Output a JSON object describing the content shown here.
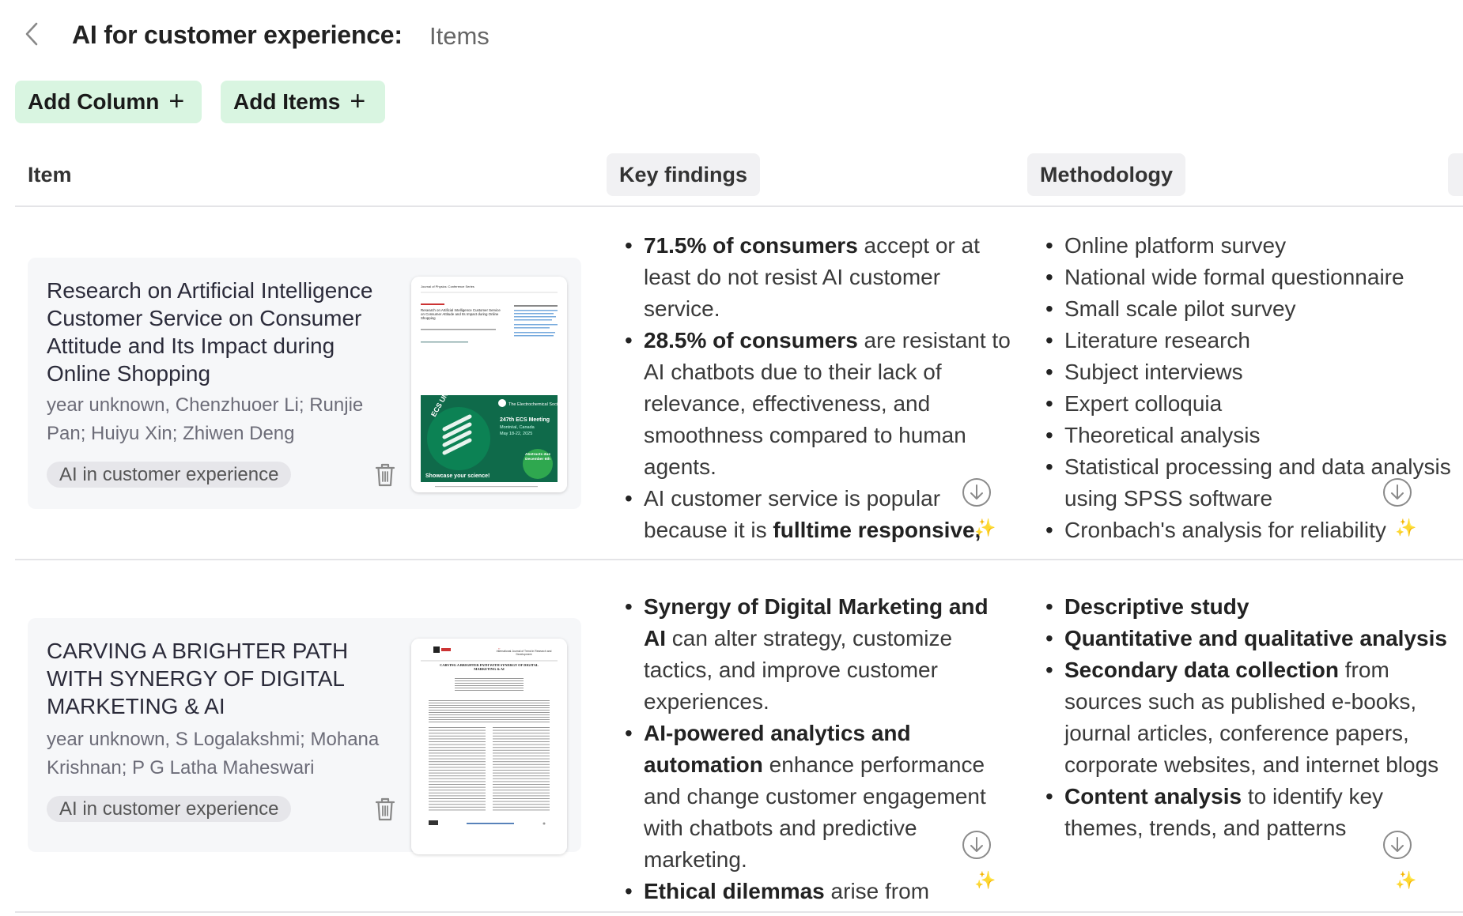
{
  "header": {
    "title": "AI for customer experience:",
    "subtitle": "Items"
  },
  "toolbar": {
    "add_column": "Add Column",
    "add_items": "Add Items",
    "plus": "+"
  },
  "columns": {
    "item": "Item",
    "key_findings": "Key findings",
    "methodology": "Methodology"
  },
  "rows": [
    {
      "title": "Research on Artificial Intelligence Customer Service on Consumer Attitude and Its Impact during Online Shopping",
      "meta": "year unknown, Chenzhuoer Li; Runjie Pan; Huiyu Xin; Zhiwen Deng",
      "tag": "AI in customer experience",
      "key_findings": [
        {
          "bold": "71.5% of consumers",
          "rest": " accept or at least do not resist AI customer service."
        },
        {
          "bold": "28.5% of consumers",
          "rest": " are resistant to AI chatbots due to their lack of relevance, effectiveness, and smoothness compared to human agents."
        },
        {
          "lead": "AI customer service is popular because it is ",
          "bold": "fulltime responsive,"
        }
      ],
      "methodology": [
        "Online platform survey",
        "National wide formal questionnaire",
        "Small scale pilot survey",
        "Literature research",
        "Subject interviews",
        "Expert colloquia",
        "Theoretical analysis",
        "Statistical processing and data analysis using SPSS software",
        "Cronbach's analysis for reliability"
      ]
    },
    {
      "title": "CARVING A BRIGHTER PATH WITH SYNERGY OF DIGITAL MARKETING & AI",
      "meta": "year unknown, S Logalakshmi; Mohana Krishnan; P G Latha Maheswari",
      "tag": "AI in customer experience",
      "key_findings": [
        {
          "bold": "Synergy of Digital Marketing and AI",
          "rest": " can alter strategy, customize tactics, and improve customer experiences."
        },
        {
          "bold": "AI-powered analytics and automation",
          "rest": " enhance performance and change customer engagement with chatbots and predictive marketing."
        },
        {
          "bold": "Ethical dilemmas",
          "rest": " arise from"
        }
      ],
      "methodology": [
        {
          "bold": "Descriptive study",
          "rest": ""
        },
        {
          "bold": "Quantitative and qualitative analysis",
          "rest": ""
        },
        {
          "bold": "Secondary data collection",
          "rest": " from sources such as published e-books, journal articles, conference papers, corporate websites, and internet blogs"
        },
        {
          "bold": "Content analysis",
          "rest": " to identify key themes, trends, and patterns"
        }
      ]
    }
  ],
  "thumbnails": {
    "paper1": {
      "journal": "Journal of Physics: Conference Series",
      "title": "Research on Artificial Intelligence Customer Service on Consumer Attitude and Its Impact during Online Shopping",
      "ad_badge": "ECS UNITED",
      "ad_society": "The Electrochemical Society",
      "ad_meeting": "247th ECS Meeting",
      "ad_location": "Montréal, Canada",
      "ad_dates": "May 18-22, 2025",
      "ad_cta": "Showcase your science!",
      "ad_deadline": "Abstracts due December 6th"
    },
    "paper2": {
      "journal": "International Journal of Trend in Research and Development",
      "title": "CARVING A BRIGHTER PATH WITH SYNERGY OF DIGITAL MARKETING & AI"
    }
  },
  "colors": {
    "accent_green": "#d9f5e1",
    "card_bg": "#f6f7f9",
    "divider": "#e4e4e7",
    "ad_bg": "#0f6a4a"
  }
}
